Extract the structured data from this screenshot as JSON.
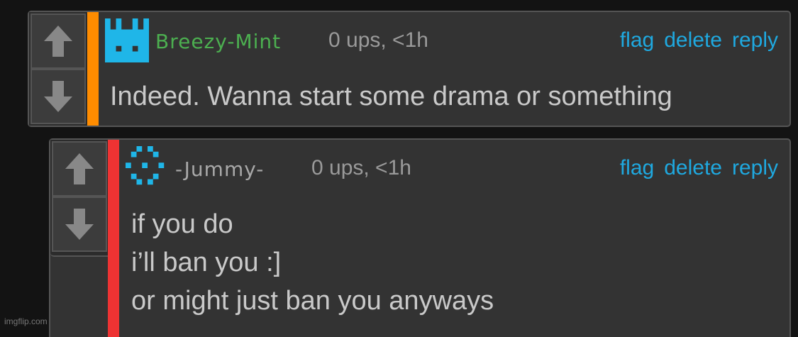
{
  "comments": [
    {
      "username": "Breezy-Mint",
      "username_color": "#4caf50",
      "meta": "0 ups, <1h",
      "bar_color": "#ff8c00",
      "avatar_color": "#1fb6e8",
      "actions": {
        "flag": "flag",
        "delete": "delete",
        "reply": "reply"
      },
      "text": "Indeed. Wanna start some drama or something"
    },
    {
      "username": "-Jummy-",
      "username_color": "#a8a8a8",
      "meta": "0 ups, <1h",
      "bar_color": "#ee3333",
      "avatar_color": "#1fb6e8",
      "actions": {
        "flag": "flag",
        "delete": "delete",
        "reply": "reply"
      },
      "text": "if you do\ni’ll ban you :]\nor might just ban you anyways"
    }
  ],
  "icons": {
    "upvote": "arrow-up-icon",
    "downvote": "arrow-down-icon"
  },
  "watermark": "imgflip.com"
}
